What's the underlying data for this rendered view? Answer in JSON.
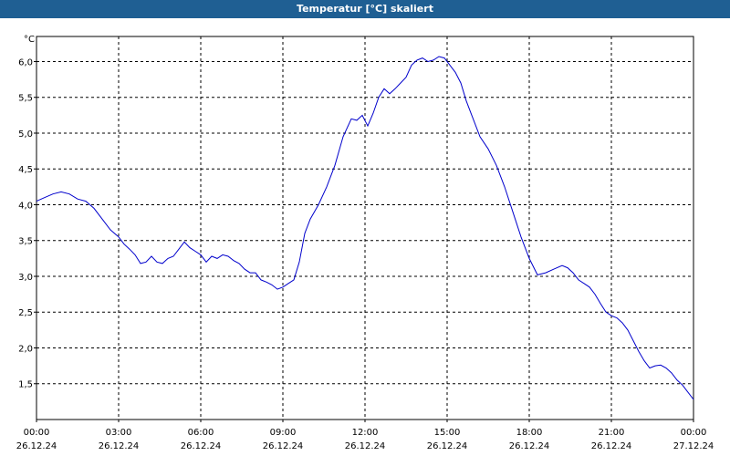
{
  "title": "Temperatur [°C] skaliert",
  "colors": {
    "titlebar": "#1f5f93",
    "line": "#0000cc",
    "grid": "#000000"
  },
  "chart_data": {
    "type": "line",
    "title": "Temperatur [°C] skaliert",
    "ylabel": "°C",
    "xlabel": "",
    "grid": true,
    "ylim": [
      1.0,
      6.35
    ],
    "xlim_hours": [
      0,
      24
    ],
    "y_ticks": [
      1.5,
      2.0,
      2.5,
      3.0,
      3.5,
      4.0,
      4.5,
      5.0,
      5.5,
      6.0
    ],
    "y_tick_labels": [
      "1,5",
      "2,0",
      "2,5",
      "3,0",
      "3,5",
      "4,0",
      "4,5",
      "5,0",
      "5,5",
      "6,0"
    ],
    "x_ticks": [
      {
        "time": "00:00",
        "date": "26.12.24"
      },
      {
        "time": "03:00",
        "date": "26.12.24"
      },
      {
        "time": "06:00",
        "date": "26.12.24"
      },
      {
        "time": "09:00",
        "date": "26.12.24"
      },
      {
        "time": "12:00",
        "date": "26.12.24"
      },
      {
        "time": "15:00",
        "date": "26.12.24"
      },
      {
        "time": "18:00",
        "date": "26.12.24"
      },
      {
        "time": "21:00",
        "date": "26.12.24"
      },
      {
        "time": "00:00",
        "date": "27.12.24"
      }
    ],
    "series": [
      {
        "x": [
          0,
          0.3,
          0.6,
          0.9,
          1.2,
          1.5,
          1.8,
          2.1,
          2.4,
          2.7,
          3.0,
          3.2,
          3.4,
          3.6,
          3.8,
          4.0,
          4.2,
          4.4,
          4.6,
          4.8,
          5.0,
          5.2,
          5.4,
          5.6,
          5.8,
          6.0,
          6.2,
          6.4,
          6.6,
          6.8,
          7.0,
          7.2,
          7.4,
          7.6,
          7.8,
          8.0,
          8.2,
          8.4,
          8.6,
          8.8,
          9.0,
          9.2,
          9.4,
          9.6,
          9.8,
          10.0,
          10.3,
          10.6,
          10.9,
          11.2,
          11.5,
          11.7,
          11.9,
          12.1,
          12.3,
          12.5,
          12.7,
          12.9,
          13.1,
          13.3,
          13.5,
          13.7,
          13.9,
          14.1,
          14.3,
          14.5,
          14.7,
          14.9,
          15.1,
          15.3,
          15.5,
          15.7,
          15.9,
          16.2,
          16.5,
          16.8,
          17.1,
          17.4,
          17.7,
          18.0,
          18.3,
          18.6,
          18.9,
          19.2,
          19.4,
          19.6,
          19.8,
          20.0,
          20.2,
          20.4,
          20.6,
          20.8,
          21.0,
          21.2,
          21.4,
          21.6,
          21.8,
          22.0,
          22.2,
          22.4,
          22.6,
          22.8,
          23.0,
          23.2,
          23.4,
          23.6,
          23.8,
          24.0
        ],
        "y": [
          4.05,
          4.1,
          4.15,
          4.18,
          4.15,
          4.08,
          4.05,
          3.95,
          3.8,
          3.65,
          3.55,
          3.45,
          3.38,
          3.3,
          3.18,
          3.2,
          3.28,
          3.2,
          3.18,
          3.25,
          3.28,
          3.38,
          3.48,
          3.4,
          3.35,
          3.3,
          3.2,
          3.28,
          3.25,
          3.3,
          3.28,
          3.22,
          3.18,
          3.1,
          3.05,
          3.05,
          2.95,
          2.92,
          2.88,
          2.82,
          2.85,
          2.9,
          2.95,
          3.2,
          3.6,
          3.8,
          4.0,
          4.25,
          4.55,
          4.95,
          5.2,
          5.18,
          5.25,
          5.1,
          5.28,
          5.5,
          5.62,
          5.55,
          5.62,
          5.7,
          5.78,
          5.95,
          6.02,
          6.05,
          6.0,
          6.02,
          6.07,
          6.05,
          5.95,
          5.85,
          5.7,
          5.45,
          5.25,
          4.95,
          4.78,
          4.55,
          4.25,
          3.9,
          3.55,
          3.25,
          3.02,
          3.05,
          3.1,
          3.15,
          3.12,
          3.05,
          2.95,
          2.9,
          2.85,
          2.75,
          2.62,
          2.5,
          2.45,
          2.42,
          2.35,
          2.25,
          2.1,
          1.95,
          1.82,
          1.72,
          1.75,
          1.76,
          1.72,
          1.65,
          1.55,
          1.48,
          1.38,
          1.28
        ]
      }
    ]
  }
}
